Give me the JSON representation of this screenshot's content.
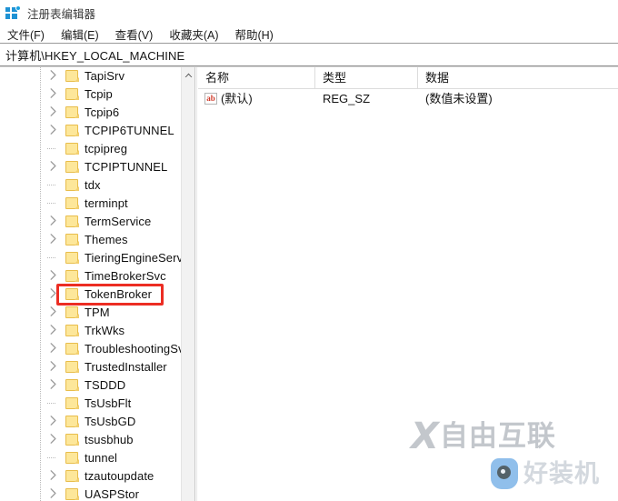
{
  "window": {
    "title": "注册表编辑器",
    "icon": "registry-editor-icon"
  },
  "menubar": {
    "items": [
      {
        "label": "文件(F)",
        "name": "menu-file"
      },
      {
        "label": "编辑(E)",
        "name": "menu-edit"
      },
      {
        "label": "查看(V)",
        "name": "menu-view"
      },
      {
        "label": "收藏夹(A)",
        "name": "menu-favorites"
      },
      {
        "label": "帮助(H)",
        "name": "menu-help"
      }
    ]
  },
  "address_bar": {
    "path": "计算机\\HKEY_LOCAL_MACHINE"
  },
  "tree": {
    "scrollbar": {
      "up_arrow": "▲"
    },
    "items": [
      {
        "label": "TapiSrv",
        "expandable": true,
        "highlighted": false
      },
      {
        "label": "Tcpip",
        "expandable": true,
        "highlighted": false
      },
      {
        "label": "Tcpip6",
        "expandable": true,
        "highlighted": false
      },
      {
        "label": "TCPIP6TUNNEL",
        "expandable": true,
        "highlighted": false
      },
      {
        "label": "tcpipreg",
        "expandable": false,
        "highlighted": false
      },
      {
        "label": "TCPIPTUNNEL",
        "expandable": true,
        "highlighted": false
      },
      {
        "label": "tdx",
        "expandable": false,
        "highlighted": false
      },
      {
        "label": "terminpt",
        "expandable": false,
        "highlighted": false
      },
      {
        "label": "TermService",
        "expandable": true,
        "highlighted": false
      },
      {
        "label": "Themes",
        "expandable": true,
        "highlighted": false
      },
      {
        "label": "TieringEngineServic",
        "expandable": false,
        "highlighted": false
      },
      {
        "label": "TimeBrokerSvc",
        "expandable": true,
        "highlighted": false
      },
      {
        "label": "TokenBroker",
        "expandable": true,
        "highlighted": true
      },
      {
        "label": "TPM",
        "expandable": true,
        "highlighted": false
      },
      {
        "label": "TrkWks",
        "expandable": true,
        "highlighted": false
      },
      {
        "label": "TroubleshootingSv",
        "expandable": true,
        "highlighted": false
      },
      {
        "label": "TrustedInstaller",
        "expandable": true,
        "highlighted": false
      },
      {
        "label": "TSDDD",
        "expandable": true,
        "highlighted": false
      },
      {
        "label": "TsUsbFlt",
        "expandable": false,
        "highlighted": false
      },
      {
        "label": "TsUsbGD",
        "expandable": true,
        "highlighted": false
      },
      {
        "label": "tsusbhub",
        "expandable": true,
        "highlighted": false
      },
      {
        "label": "tunnel",
        "expandable": false,
        "highlighted": false
      },
      {
        "label": "tzautoupdate",
        "expandable": true,
        "highlighted": false
      },
      {
        "label": "UASPStor",
        "expandable": true,
        "highlighted": false
      }
    ],
    "highlight_color": "#ec2d23"
  },
  "values": {
    "columns": [
      {
        "label": "名称",
        "name": "column-name"
      },
      {
        "label": "类型",
        "name": "column-type"
      },
      {
        "label": "数据",
        "name": "column-data"
      }
    ],
    "rows": [
      {
        "icon": "string-value-icon",
        "icon_text": "ab",
        "name": "(默认)",
        "type": "REG_SZ",
        "data": "(数值未设置)"
      }
    ]
  },
  "watermarks": {
    "primary": {
      "logo": "X",
      "text": "自由互联"
    },
    "secondary": {
      "icon": "camera-badge-icon",
      "text": "好装机"
    }
  }
}
